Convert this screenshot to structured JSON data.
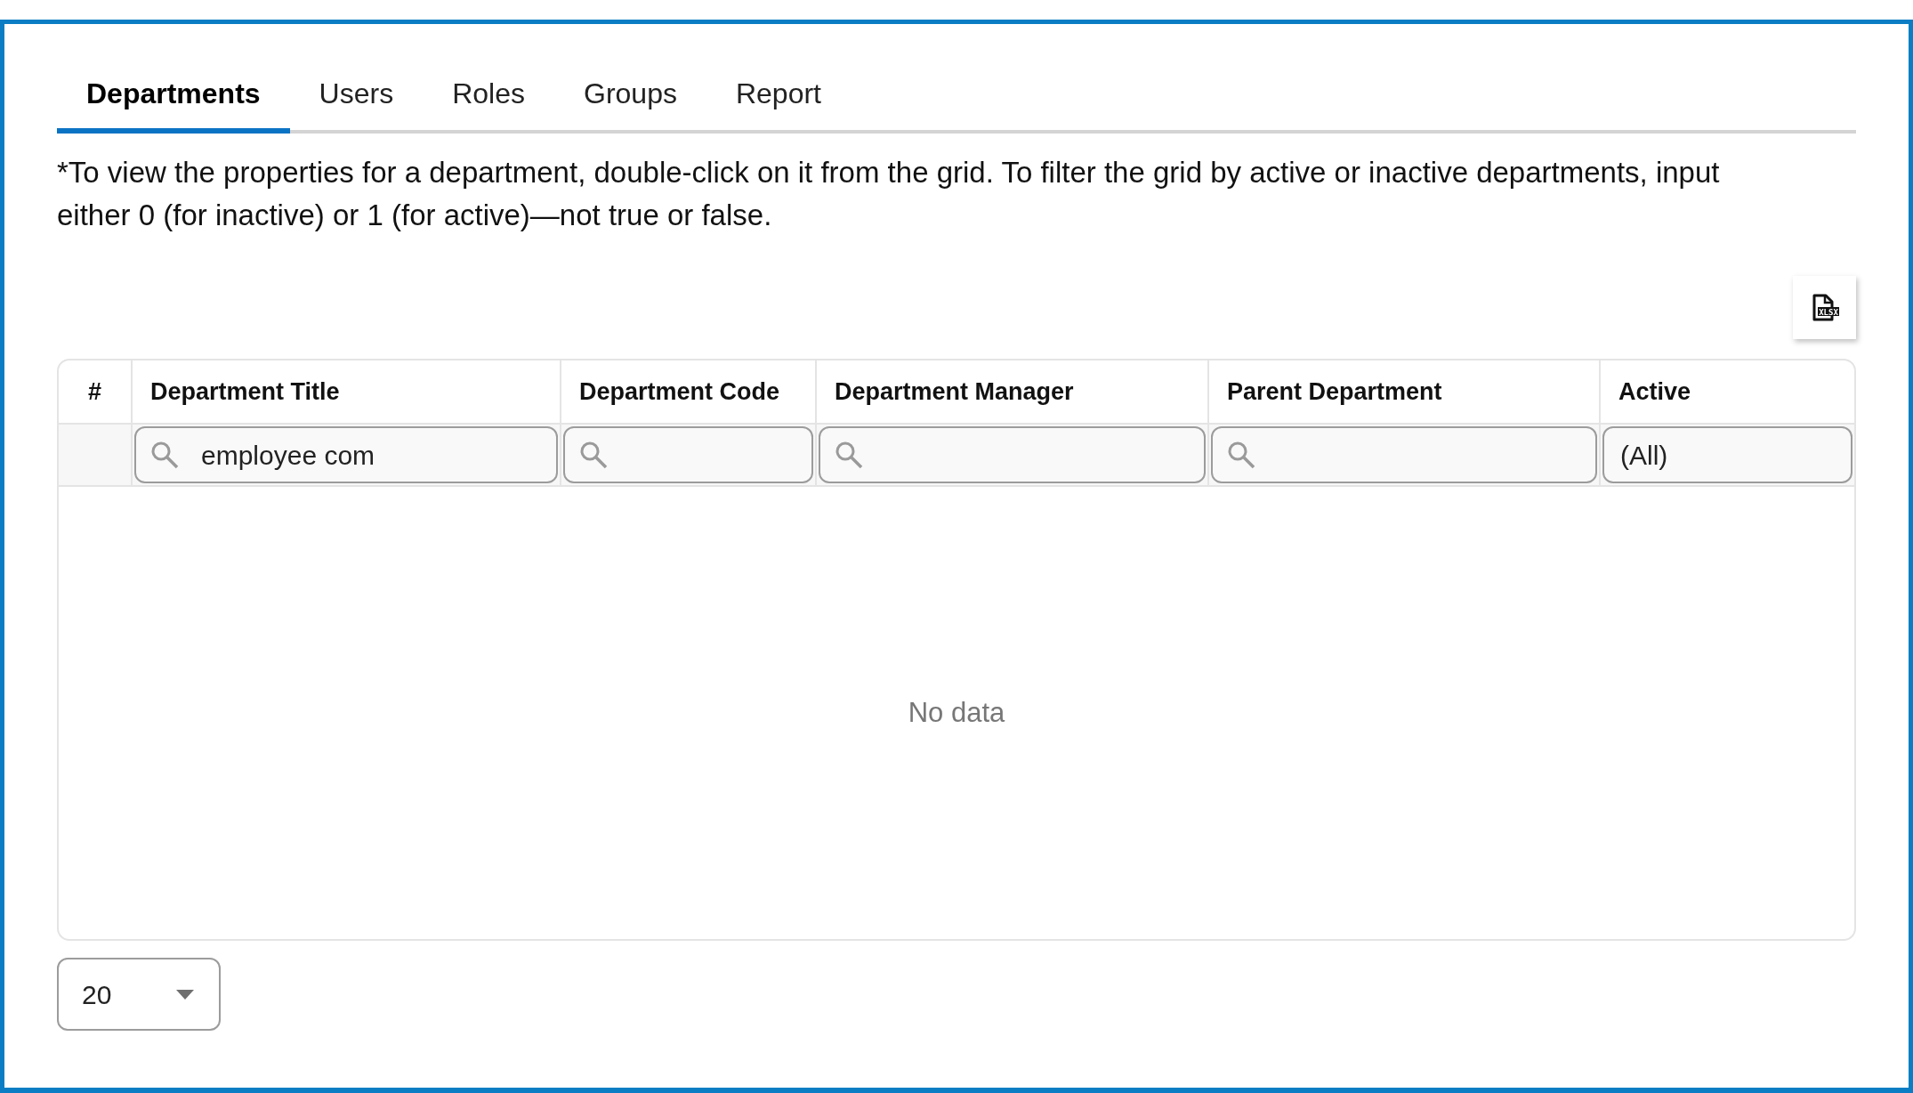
{
  "tabs": [
    {
      "label": "Departments",
      "selected": true
    },
    {
      "label": "Users",
      "selected": false
    },
    {
      "label": "Roles",
      "selected": false
    },
    {
      "label": "Groups",
      "selected": false
    },
    {
      "label": "Report",
      "selected": false
    }
  ],
  "description": "*To view the properties for a department, double-click on it from the grid. To filter the grid by active or inactive departments, input either 0 (for inactive) or 1 (for active)—not true or false.",
  "export_button": {
    "icon_label": "XLSX"
  },
  "table": {
    "columns": [
      {
        "label": "#",
        "kind": "index"
      },
      {
        "label": "Department Title",
        "kind": "search",
        "value": "employee com"
      },
      {
        "label": "Department Code",
        "kind": "search"
      },
      {
        "label": "Department Manager",
        "kind": "search"
      },
      {
        "label": "Parent Department",
        "kind": "search"
      },
      {
        "label": "Active",
        "kind": "select",
        "value": "(All)"
      }
    ],
    "empty_text": "No data"
  },
  "page_size": "20"
}
